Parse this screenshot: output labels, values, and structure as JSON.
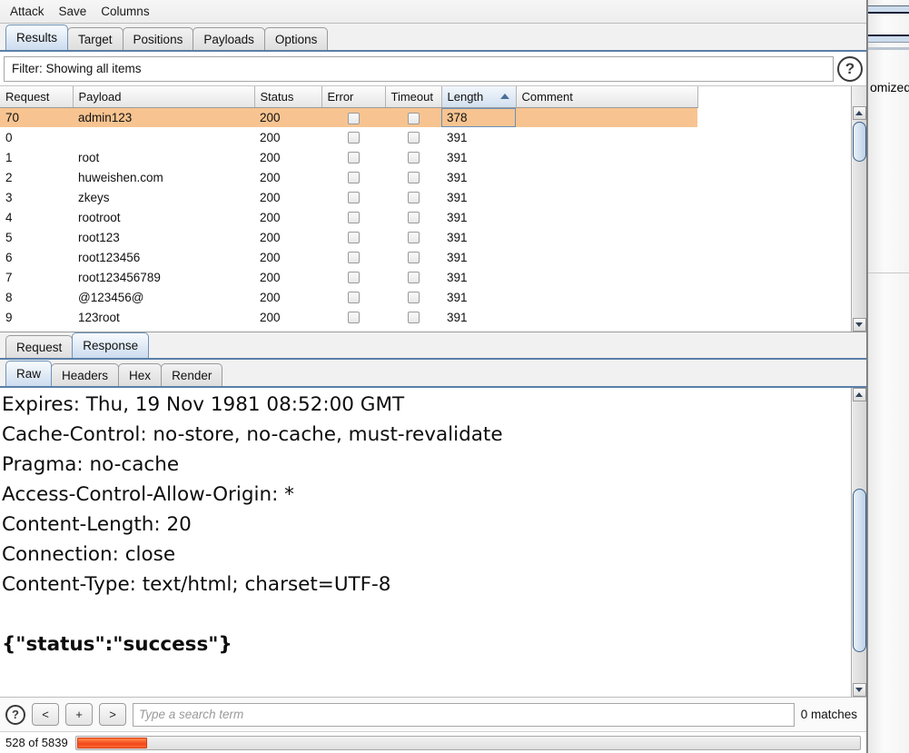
{
  "menubar": {
    "items": [
      {
        "label": "Attack"
      },
      {
        "label": "Save"
      },
      {
        "label": "Columns"
      }
    ]
  },
  "tabs": [
    {
      "label": "Results",
      "active": true
    },
    {
      "label": "Target",
      "active": false
    },
    {
      "label": "Positions",
      "active": false
    },
    {
      "label": "Payloads",
      "active": false
    },
    {
      "label": "Options",
      "active": false
    }
  ],
  "filter": {
    "text": "Filter: Showing all items",
    "help_icon": "help-circle-icon",
    "help_glyph": "?"
  },
  "results_table": {
    "columns": [
      {
        "label": "Request",
        "sorted": false
      },
      {
        "label": "Payload",
        "sorted": false
      },
      {
        "label": "Status",
        "sorted": false
      },
      {
        "label": "Error",
        "sorted": false
      },
      {
        "label": "Timeout",
        "sorted": false
      },
      {
        "label": "Length",
        "sorted": true,
        "sort_dir": "ascending"
      },
      {
        "label": "Comment",
        "sorted": false
      }
    ],
    "rows": [
      {
        "request": "70",
        "payload": "admin123",
        "status": "200",
        "error": false,
        "timeout": false,
        "length": "378",
        "comment": "",
        "highlighted": true
      },
      {
        "request": "0",
        "payload": "",
        "status": "200",
        "error": false,
        "timeout": false,
        "length": "391",
        "comment": "",
        "highlighted": false
      },
      {
        "request": "1",
        "payload": "root",
        "status": "200",
        "error": false,
        "timeout": false,
        "length": "391",
        "comment": "",
        "highlighted": false
      },
      {
        "request": "2",
        "payload": "huweishen.com",
        "status": "200",
        "error": false,
        "timeout": false,
        "length": "391",
        "comment": "",
        "highlighted": false
      },
      {
        "request": "3",
        "payload": "zkeys",
        "status": "200",
        "error": false,
        "timeout": false,
        "length": "391",
        "comment": "",
        "highlighted": false
      },
      {
        "request": "4",
        "payload": "rootroot",
        "status": "200",
        "error": false,
        "timeout": false,
        "length": "391",
        "comment": "",
        "highlighted": false
      },
      {
        "request": "5",
        "payload": "root123",
        "status": "200",
        "error": false,
        "timeout": false,
        "length": "391",
        "comment": "",
        "highlighted": false
      },
      {
        "request": "6",
        "payload": "root123456",
        "status": "200",
        "error": false,
        "timeout": false,
        "length": "391",
        "comment": "",
        "highlighted": false
      },
      {
        "request": "7",
        "payload": "root123456789",
        "status": "200",
        "error": false,
        "timeout": false,
        "length": "391",
        "comment": "",
        "highlighted": false
      },
      {
        "request": "8",
        "payload": "@123456@",
        "status": "200",
        "error": false,
        "timeout": false,
        "length": "391",
        "comment": "",
        "highlighted": false
      },
      {
        "request": "9",
        "payload": "123root",
        "status": "200",
        "error": false,
        "timeout": false,
        "length": "391",
        "comment": "",
        "highlighted": false
      }
    ]
  },
  "message_tabs": [
    {
      "label": "Request",
      "active": false
    },
    {
      "label": "Response",
      "active": true
    }
  ],
  "view_tabs": [
    {
      "label": "Raw",
      "active": true
    },
    {
      "label": "Headers",
      "active": false
    },
    {
      "label": "Hex",
      "active": false
    },
    {
      "label": "Render",
      "active": false
    }
  ],
  "response": {
    "lines": [
      {
        "text": "Expires: Thu, 19 Nov 1981 08:52:00 GMT",
        "bold": false
      },
      {
        "text": "Cache-Control: no-store, no-cache, must-revalidate",
        "bold": false
      },
      {
        "text": "Pragma: no-cache",
        "bold": false
      },
      {
        "text": "Access-Control-Allow-Origin: *",
        "bold": false
      },
      {
        "text": "Content-Length: 20",
        "bold": false
      },
      {
        "text": "Connection: close",
        "bold": false
      },
      {
        "text": "Content-Type: text/html; charset=UTF-8",
        "bold": false
      },
      {
        "text": "",
        "bold": false
      },
      {
        "text": "{\"status\":\"success\"}",
        "bold": true
      }
    ]
  },
  "search": {
    "help_glyph": "?",
    "prev_label": "<",
    "add_label": "+",
    "next_label": ">",
    "placeholder": "Type a search term",
    "value": "",
    "matches": "0 matches"
  },
  "progress": {
    "status": "528 of 5839",
    "completed": 528,
    "total": 5839,
    "percent": 9,
    "bar_color": "#f3461a"
  },
  "background_window": {
    "visible_text": "omized"
  },
  "colors": {
    "highlight_row": "#f7c491",
    "tab_active": "#ccdcef",
    "accent_border": "#5a7fa8",
    "progress": "#f3461a"
  }
}
